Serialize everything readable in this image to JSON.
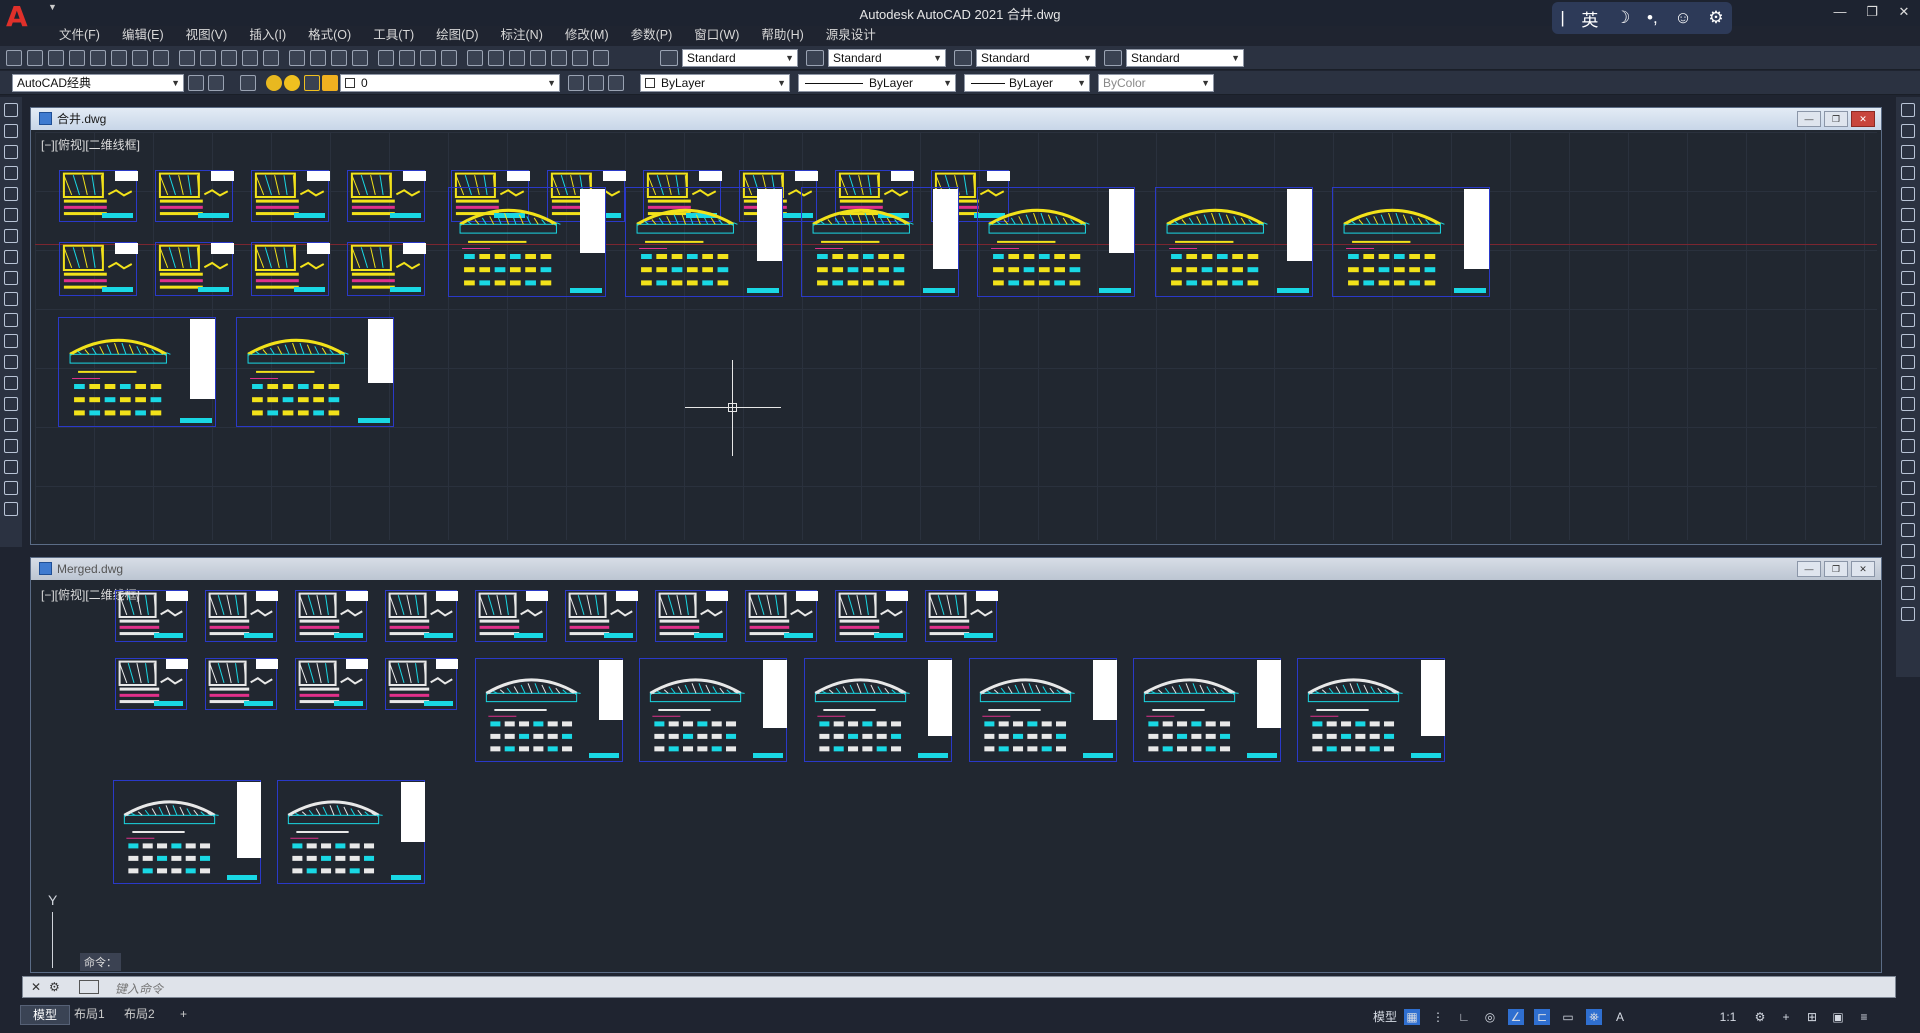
{
  "app": {
    "title": "Autodesk AutoCAD 2021    合井.dwg",
    "logo": "A",
    "window_controls": [
      "—",
      "❐",
      "✕"
    ]
  },
  "ime": {
    "items": [
      "|",
      "英",
      "☽",
      "•,",
      "☺",
      "⚙"
    ]
  },
  "menu": {
    "items": [
      "文件(F)",
      "编辑(E)",
      "视图(V)",
      "插入(I)",
      "格式(O)",
      "工具(T)",
      "绘图(D)",
      "标注(N)",
      "修改(M)",
      "参数(P)",
      "窗口(W)",
      "帮助(H)",
      "源泉设计"
    ]
  },
  "toolbar1": {
    "text_style": "Standard",
    "dim_style": "Standard",
    "table_style": "Standard",
    "mleader_style": "Standard"
  },
  "toolbar2": {
    "workspace": "AutoCAD经典",
    "layer": "0",
    "color": "ByLayer",
    "linetype": "ByLayer",
    "lineweight": "ByLayer",
    "plotstyle": "ByColor"
  },
  "viewport1": {
    "title": "合井.dwg",
    "label": "[−][俯视][二维线框]",
    "active": true
  },
  "viewport2": {
    "title": "Merged.dwg",
    "label": "[−][俯视][二维线框]",
    "active": false
  },
  "ucs": {
    "y_label": "Y"
  },
  "command": {
    "tooltip": "命令：",
    "placeholder": "键入命令"
  },
  "layout_tabs": [
    "模型",
    "布局1",
    "布局2",
    "+"
  ],
  "status": {
    "model": "模型",
    "scale": "1:1",
    "icons": [
      "grid-icon",
      "snap-icon",
      "ortho-icon",
      "polar-icon",
      "osnap-icon",
      "otrack-icon",
      "lineweight-icon",
      "annotation-icon",
      "workspace-gear-icon",
      "fullscreen-icon",
      "customize-icon"
    ]
  },
  "colors": {
    "canvas_bg": "#212730",
    "sheet_border": "#2a39c8",
    "accent_yellow": "#f2e21a",
    "accent_cyan": "#19d8e4",
    "logo_red": "#e0302a"
  }
}
